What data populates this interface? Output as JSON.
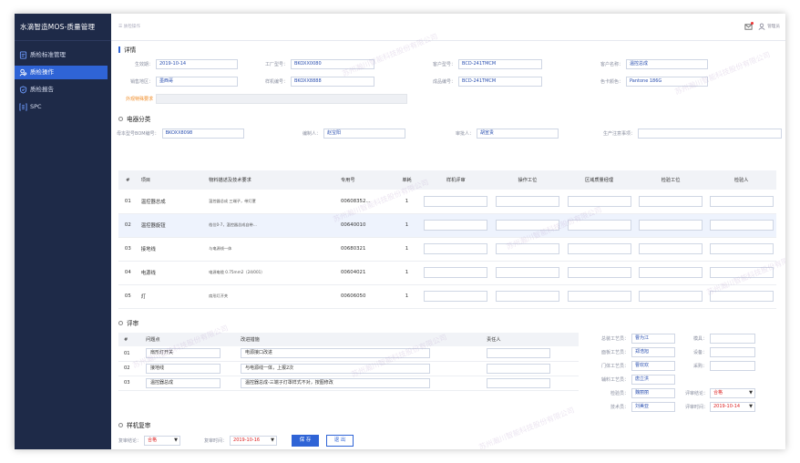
{
  "app": {
    "title": "水滴智造MOS-质量管理"
  },
  "nav": [
    {
      "label": "质检标准管理",
      "icon": "document-icon",
      "active": false
    },
    {
      "label": "质检操作",
      "icon": "users-icon",
      "active": true
    },
    {
      "label": "质检报告",
      "icon": "shield-icon",
      "active": false
    },
    {
      "label": "SPC",
      "icon": "spc-icon",
      "active": false
    }
  ],
  "header": {
    "breadcrumb": "质检操作",
    "user": "管理员"
  },
  "watermark": "苏州瀚川智能科技股份有限公司",
  "details": {
    "title": "详情",
    "fields": {
      "prod_date": {
        "label": "生效期：",
        "value": "2019-10-14"
      },
      "factory_model": {
        "label": "工厂型号：",
        "value": "BKOXX0080"
      },
      "customer_model": {
        "label": "客户型号：",
        "value": "BCD-241TMCM"
      },
      "customer_name": {
        "label": "客户名称：",
        "value": "温控总成"
      },
      "sales_region": {
        "label": "销售地区：",
        "value": "墨西哥"
      },
      "sample_no": {
        "label": "样机编号：",
        "value": "BKOXX8888"
      },
      "product_no": {
        "label": "成品编号：",
        "value": "BCD-241TMCM"
      },
      "color_no": {
        "label": "色卡颜色：",
        "value": "Pantone 186G"
      }
    },
    "special_label": "外观特殊要求",
    "special_value": ""
  },
  "electrical": {
    "title": "电器分类",
    "bom": {
      "label": "母本型号BOM编号：",
      "value": "BKOXX8098"
    },
    "recorder": {
      "label": "编制人：",
      "value": "赵宝阳"
    },
    "reviewer": {
      "label": "审批人：",
      "value": "胡宣贵"
    },
    "notes": {
      "label": "生产注意事项：",
      "value": ""
    },
    "headers": [
      "#",
      "项目",
      "物料描述及技术要求",
      "专用号",
      "单耗",
      "样机评审",
      "操作工位",
      "区域质量经理",
      "检验工位",
      "检验人"
    ],
    "rows": [
      {
        "no": "01",
        "item": "温控器总成",
        "desc": "温控器总成 三端子，带灯罩",
        "code": "00608352...",
        "qty": "1"
      },
      {
        "no": "02",
        "item": "温控器旋钮",
        "desc": "档位0-7，温控器总成自带...",
        "code": "00640010",
        "qty": "1"
      },
      {
        "no": "03",
        "item": "接地线",
        "desc": "与电源线一体",
        "code": "00680321",
        "qty": "1"
      },
      {
        "no": "04",
        "item": "电源线",
        "desc": "电源电缆 0.75mm2（24/001）",
        "code": "00604021",
        "qty": "1"
      },
      {
        "no": "05",
        "item": "灯",
        "desc": "扇形灯开关",
        "code": "00606050",
        "qty": "1"
      }
    ]
  },
  "review": {
    "title": "评审",
    "headers": [
      "#",
      "问题点",
      "改进措施",
      "责任人"
    ],
    "rows": [
      {
        "no": "01",
        "issue": "扇形灯开关",
        "action": "电源接口改进",
        "owner": ""
      },
      {
        "no": "02",
        "issue": "接地线",
        "action": "与电源线一体，上报2次",
        "owner": ""
      },
      {
        "no": "03",
        "issue": "温控器总成",
        "action": "温控器总成-三端子灯罩样式不对，按图修改",
        "owner": ""
      }
    ],
    "side": [
      {
        "label": "总装工艺员：",
        "value": "曹为江"
      },
      {
        "label": "面板工艺员：",
        "value": "郑浩旭"
      },
      {
        "label": "门体工艺员：",
        "value": "曹欢欢"
      },
      {
        "label": "辅料工艺员：",
        "value": "唐立洪"
      },
      {
        "label": "检验员：",
        "value": "魏丽丽"
      },
      {
        "label": "技术员：",
        "value": "刘美亚"
      }
    ],
    "side2": [
      {
        "label": "模具：",
        "value": ""
      },
      {
        "label": "设备：",
        "value": ""
      },
      {
        "label": "采购：",
        "value": ""
      }
    ],
    "conclusion": {
      "label": "评审结论：",
      "value": "合格"
    },
    "date": {
      "label": "评审时间：",
      "value": "2019-10-14"
    }
  },
  "sample": {
    "title": "样机复审",
    "conclusion": {
      "label": "复审结论：",
      "value": "合格"
    },
    "date": {
      "label": "复审时间：",
      "value": "2019-10-16"
    }
  },
  "buttons": {
    "save": "保 存",
    "back": "退 出"
  },
  "colors": {
    "sidebar": "#1e2a48",
    "accent": "#2f64d6",
    "value_text": "#2a4fb0",
    "warning": "#f08a24"
  }
}
